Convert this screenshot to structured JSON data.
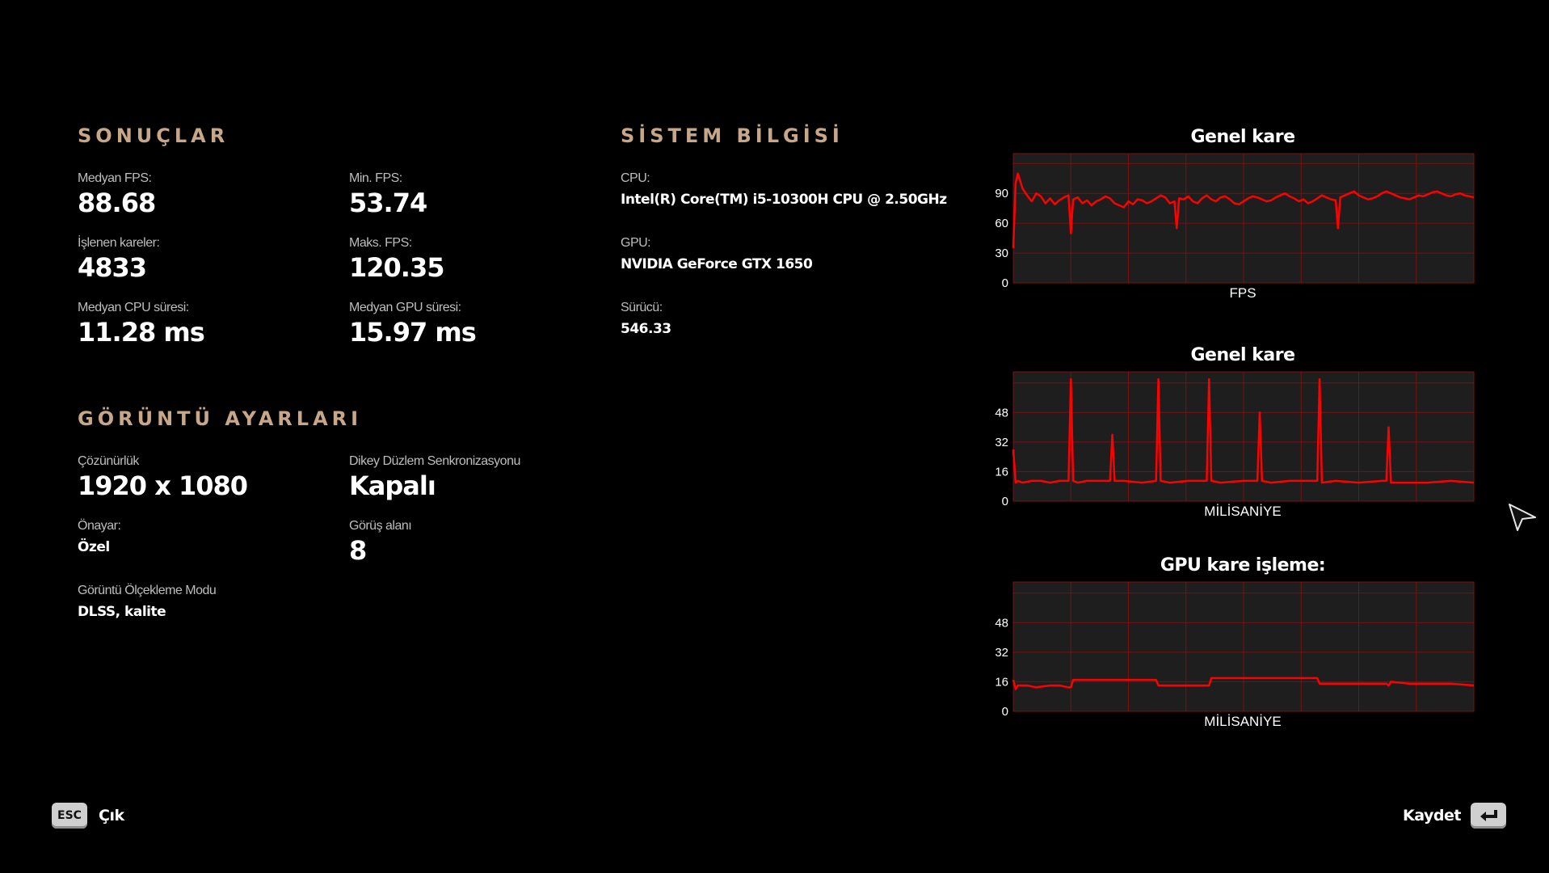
{
  "results": {
    "title": "SONUÇLAR",
    "median_fps": {
      "label": "Medyan FPS:",
      "value": "88.68"
    },
    "min_fps": {
      "label": "Min. FPS:",
      "value": "53.74"
    },
    "rendered_frames": {
      "label": "İşlenen kareler:",
      "value": "4833"
    },
    "max_fps": {
      "label": "Maks. FPS:",
      "value": "120.35"
    },
    "median_cpu": {
      "label": "Medyan CPU süresi:",
      "value": "11.28 ms"
    },
    "median_gpu": {
      "label": "Medyan GPU süresi:",
      "value": "15.97 ms"
    }
  },
  "system": {
    "title": "SİSTEM BİLGİSİ",
    "cpu": {
      "label": "CPU:",
      "value": "Intel(R) Core(TM) i5-10300H CPU @ 2.50GHz"
    },
    "gpu": {
      "label": "GPU:",
      "value": "NVIDIA GeForce GTX 1650"
    },
    "driver": {
      "label": "Sürücü:",
      "value": "546.33"
    }
  },
  "display": {
    "title": "GÖRÜNTÜ AYARLARI",
    "resolution": {
      "label": "Çözünürlük",
      "value": "1920 x 1080"
    },
    "vsync": {
      "label": "Dikey Düzlem Senkronizasyonu",
      "value": "Kapalı"
    },
    "preset": {
      "label": "Önayar:",
      "value": "Özel"
    },
    "fov": {
      "label": "Görüş alanı",
      "value": "8"
    },
    "scaling": {
      "label": "Görüntü Ölçekleme Modu",
      "value": "DLSS, kalite"
    }
  },
  "footer": {
    "exit_key": "ESC",
    "exit_label": "Çık",
    "save_label": "Kaydet",
    "enter_key_icon": "enter-icon"
  },
  "colors": {
    "accent": "#c8a788",
    "series": "#ff0000",
    "plot_bg": "#1e1e1e",
    "grid": "#7a1010"
  },
  "chart_data": [
    {
      "type": "line",
      "title": "Genel kare",
      "xlabel": "FPS",
      "ylabel": "",
      "yticks": [
        0,
        30,
        60,
        90
      ],
      "ylim": [
        0,
        130
      ],
      "grid": true,
      "series": [
        {
          "x": [
            0,
            0.5,
            1,
            2,
            3,
            4,
            5,
            6,
            7,
            8,
            9,
            10,
            11,
            12,
            12.5,
            13,
            14,
            15,
            16,
            17,
            18,
            19,
            20,
            21,
            22,
            23,
            24,
            25,
            26,
            27,
            28,
            29,
            30,
            31,
            32,
            33,
            34,
            35,
            35.5,
            36,
            37,
            38,
            39,
            40,
            41,
            42,
            43,
            44,
            45,
            46,
            47,
            48,
            49,
            50,
            51,
            52,
            53,
            54,
            55,
            56,
            57,
            58,
            59,
            60,
            61,
            62,
            63,
            64,
            65,
            66,
            67,
            68,
            69,
            70,
            70.5,
            71,
            72,
            73,
            74,
            75,
            76,
            77,
            78,
            79,
            80,
            81,
            82,
            83,
            84,
            85,
            86,
            87,
            88,
            89,
            90,
            91,
            92,
            93,
            94,
            95,
            96,
            97,
            98,
            99,
            100
          ],
          "values": [
            35,
            100,
            110,
            95,
            88,
            82,
            90,
            87,
            80,
            85,
            79,
            83,
            86,
            88,
            50,
            84,
            86,
            80,
            83,
            78,
            82,
            84,
            87,
            85,
            80,
            78,
            76,
            82,
            79,
            84,
            83,
            80,
            82,
            85,
            88,
            86,
            80,
            82,
            55,
            85,
            84,
            87,
            82,
            80,
            85,
            88,
            84,
            82,
            86,
            87,
            84,
            80,
            79,
            82,
            85,
            87,
            86,
            84,
            82,
            83,
            86,
            88,
            90,
            87,
            85,
            82,
            84,
            80,
            82,
            85,
            88,
            86,
            84,
            83,
            55,
            86,
            88,
            90,
            92,
            88,
            86,
            84,
            85,
            87,
            90,
            92,
            90,
            88,
            86,
            85,
            84,
            86,
            88,
            87,
            89,
            91,
            92,
            90,
            88,
            87,
            89,
            90,
            88,
            87,
            86
          ]
        }
      ]
    },
    {
      "type": "line",
      "title": "Genel kare",
      "xlabel": "MİLİSANİYE",
      "ylabel": "",
      "yticks": [
        0,
        16,
        32,
        48
      ],
      "ylim": [
        0,
        70
      ],
      "grid": true,
      "series": [
        {
          "x": [
            0,
            0.5,
            1,
            2,
            4,
            6,
            8,
            10,
            12,
            12.5,
            13,
            14,
            16,
            20,
            21,
            21.5,
            22,
            24,
            28,
            31,
            31.5,
            32,
            34,
            38,
            42,
            42.5,
            43,
            45,
            50,
            53,
            53.5,
            54,
            56,
            60,
            65,
            66,
            66.5,
            67,
            70,
            75,
            80,
            81,
            81.5,
            82,
            85,
            90,
            95,
            100
          ],
          "values": [
            28,
            10,
            11,
            10,
            11,
            11,
            10,
            11,
            11,
            66,
            11,
            10,
            11,
            11,
            11,
            36,
            11,
            11,
            10,
            11,
            66,
            11,
            10,
            11,
            11,
            66,
            11,
            10,
            11,
            11,
            48,
            11,
            10,
            11,
            11,
            11,
            66,
            10,
            11,
            10,
            11,
            11,
            40,
            10,
            10,
            10,
            11,
            10
          ]
        }
      ]
    },
    {
      "type": "line",
      "title": "GPU kare işleme:",
      "xlabel": "MİLİSANİYE",
      "ylabel": "",
      "yticks": [
        0,
        16,
        32,
        48
      ],
      "ylim": [
        0,
        70
      ],
      "grid": true,
      "series": [
        {
          "x": [
            0,
            0.5,
            1,
            3,
            5,
            8,
            10,
            12,
            12.5,
            13,
            16,
            20,
            25,
            30,
            31,
            31.5,
            32,
            36,
            42,
            42.5,
            43,
            46,
            50,
            55,
            60,
            65,
            66,
            66.5,
            67,
            72,
            78,
            81,
            81.5,
            82,
            86,
            90,
            95,
            100
          ],
          "values": [
            17,
            12,
            14,
            14,
            13,
            14,
            14,
            13,
            13,
            17,
            17,
            17,
            17,
            17,
            17,
            14,
            14,
            14,
            14,
            14,
            18,
            18,
            18,
            18,
            18,
            18,
            18,
            15,
            15,
            15,
            15,
            15,
            14,
            16,
            15,
            15,
            15,
            14
          ]
        }
      ]
    }
  ]
}
